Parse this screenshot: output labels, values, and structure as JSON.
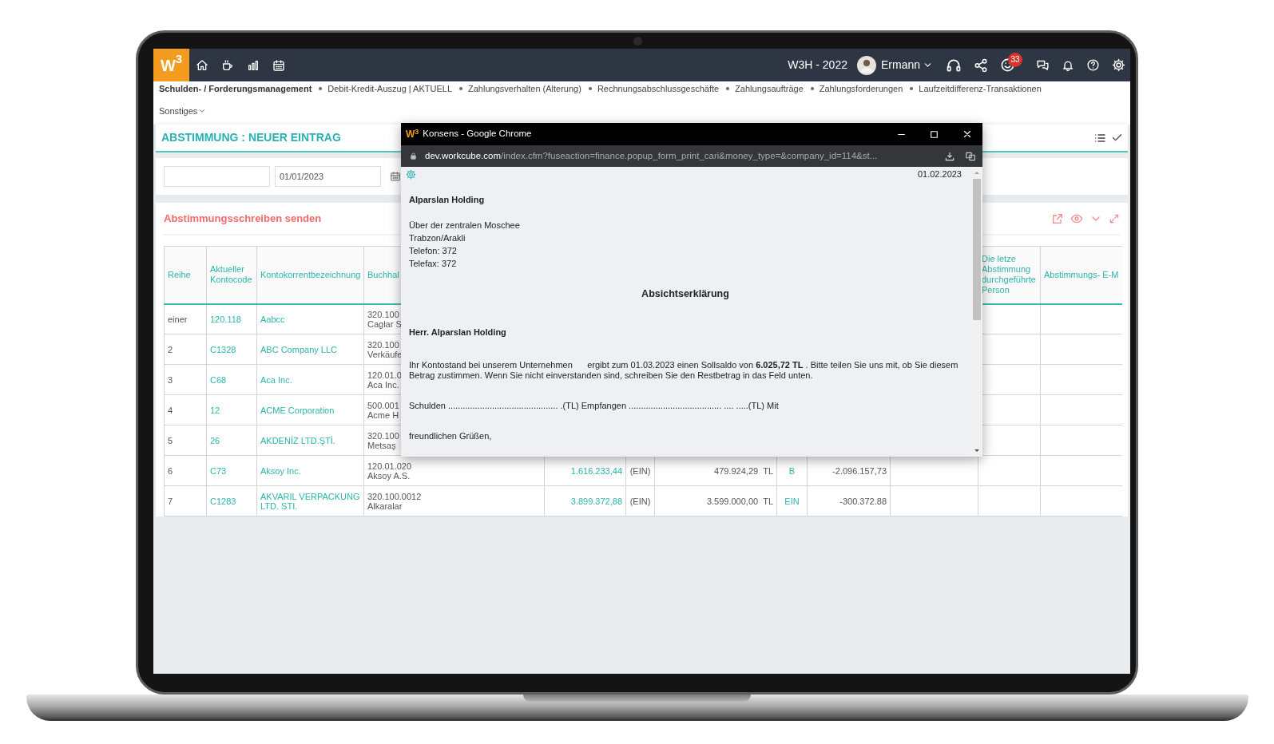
{
  "app": {
    "logo": "W$^{3}$",
    "company": "W3H - 2022",
    "user": "Ermann",
    "notification_count": "33"
  },
  "nav": {
    "items": [
      {
        "label": "Schulden- / Forderungsmanagement",
        "kind": "current"
      },
      {
        "label": "Debit-Kredit-Auszug | AKTUELL",
        "kind": "link"
      },
      {
        "label": "Zahlungsverhalten (Alterung)",
        "kind": "link"
      },
      {
        "label": "Rechnungsabschlussgeschäfte",
        "kind": "link"
      },
      {
        "label": "Zahlungsaufträge",
        "kind": "link"
      },
      {
        "label": "Zahlungsforderungen",
        "kind": "link"
      },
      {
        "label": "Laufzeitdifferenz-Transaktionen",
        "kind": "link"
      }
    ],
    "more": "Sonstiges"
  },
  "page_title": "ABSTIMMUNG : NEUER EINTRAG",
  "filters": {
    "date": "01/01/2023"
  },
  "section_title": "Abstimmungsschreiben senden",
  "table": {
    "columns": [
      {
        "label": "Reihe"
      },
      {
        "label": "Aktueller Kontocode"
      },
      {
        "label": "Kontokorrentbezeichnung"
      },
      {
        "label": "Buchhal"
      },
      {},
      {},
      {},
      {},
      {},
      {},
      {
        "label": "Die letze Abstimmung durchgeführte Person"
      },
      {
        "label": "Abstimmungs- E-M"
      }
    ],
    "rows": [
      {
        "cells": [
          {
            "lines": [
              "einer"
            ]
          },
          {
            "lines": [
              "120.118"
            ]
          },
          {
            "lines": [
              "Aabcc"
            ]
          },
          {
            "lines": [
              "320.100",
              "Caglar S"
            ]
          },
          {},
          {},
          {},
          {},
          {},
          {},
          {},
          {}
        ]
      },
      {
        "cells": [
          {
            "lines": [
              "2"
            ]
          },
          {
            "lines": [
              "C1328"
            ]
          },
          {
            "lines": [
              "ABC Company LLC"
            ]
          },
          {
            "lines": [
              "320.100",
              "Verkäufe"
            ]
          },
          {},
          {},
          {},
          {},
          {},
          {},
          {},
          {}
        ]
      },
      {
        "cells": [
          {
            "lines": [
              "3"
            ]
          },
          {
            "lines": [
              "C68"
            ]
          },
          {
            "lines": [
              "Aca Inc."
            ]
          },
          {
            "lines": [
              "120.01.0",
              "Aca Inc."
            ]
          },
          {},
          {},
          {},
          {},
          {},
          {},
          {},
          {}
        ]
      },
      {
        "cells": [
          {
            "lines": [
              "4"
            ]
          },
          {
            "lines": [
              "12"
            ]
          },
          {
            "lines": [
              "ACME Corporation"
            ]
          },
          {
            "lines": [
              "500.001",
              "Acme H"
            ]
          },
          {},
          {},
          {},
          {},
          {},
          {},
          {},
          {}
        ]
      },
      {
        "cells": [
          {
            "lines": [
              "5"
            ]
          },
          {
            "lines": [
              "26"
            ]
          },
          {
            "lines": [
              "AKDENİZ LTD.ŞTİ."
            ]
          },
          {
            "lines": [
              "320.100",
              "Metsaş"
            ]
          },
          {},
          {},
          {},
          {},
          {},
          {},
          {},
          {}
        ]
      },
      {
        "cells": [
          {
            "lines": [
              "6"
            ]
          },
          {
            "lines": [
              "C73"
            ]
          },
          {
            "lines": [
              "Aksoy Inc."
            ]
          },
          {
            "lines": [
              "120.01.020",
              "Aksoy A.S."
            ]
          },
          {
            "lines": [
              "1.616.233,44"
            ]
          },
          {
            "lines": [
              "(EIN)"
            ]
          },
          {
            "lines": [
              "479.924,29"
            ],
            "unit": "TL"
          },
          {
            "lines": [
              "B"
            ]
          },
          {
            "lines": [
              "-2.096.157,73"
            ]
          },
          {},
          {},
          {}
        ]
      },
      {
        "cells": [
          {
            "lines": [
              "7"
            ]
          },
          {
            "lines": [
              "C1283"
            ]
          },
          {
            "lines": [
              "AKVARIL VERPACKUNG LTD. STI."
            ]
          },
          {
            "lines": [
              "320.100.0012",
              "Alkaralar"
            ]
          },
          {
            "lines": [
              "3.899.372,88"
            ]
          },
          {
            "lines": [
              "(EIN)"
            ]
          },
          {
            "lines": [
              "3.599.000,00"
            ],
            "unit": "TL"
          },
          {
            "lines": [
              "EIN"
            ]
          },
          {
            "lines": [
              "-300.372.88"
            ]
          },
          {},
          {},
          {}
        ]
      }
    ]
  },
  "popup": {
    "logo": "W$^{3}$",
    "window_title": "Konsens - Google Chrome",
    "url_host": "dev.workcube.com",
    "url_path": "/index.cfm?fuseaction=finance.popup_form_print_cari&money_type=&company_id=114&st...",
    "date": "01.02.2023",
    "company": "Alparslan Holding",
    "address_lines": [
      "Über der zentralen Moschee",
      "Trabzon/Arakli",
      "Telefon: 372",
      "Telefax: 372"
    ],
    "heading": "Absichtserklärung",
    "salutation": "Herr. Alparslan Holding",
    "body": "Ihr Kontostand bei unserem Unternehmen      ergibt zum 01.03.2023 einen Sollsaldo von **6.025,72 TL** . Bitte teilen Sie uns mit, ob Sie diesem Betrag zustimmen. Wenn Sie nicht einverstanden sind, schreiben Sie den Restbetrag in das Feld unten.",
    "form_line": "Schulden ............................................. .(TL) Empfangen ...................................... .... .....(TL) Mit",
    "closing": "freundlichen Grüßen,"
  }
}
